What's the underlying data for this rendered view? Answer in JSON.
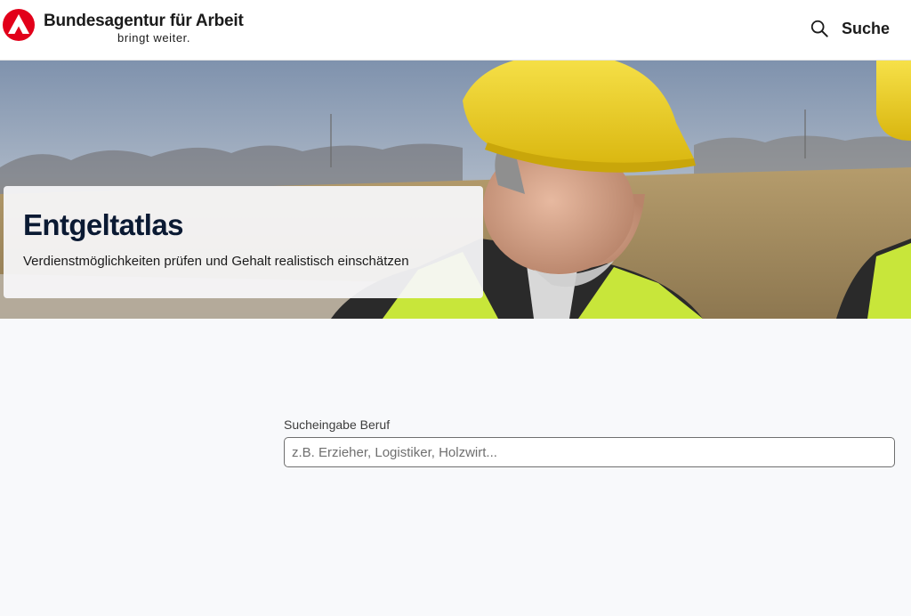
{
  "header": {
    "logo_name": "Bundesagentur für Arbeit",
    "logo_claim": "bringt weiter.",
    "logo_icon": "ba-logo-icon",
    "search_icon": "search-icon",
    "search_label": "Suche"
  },
  "hero": {
    "title": "Entgeltatlas",
    "subtitle": "Verdienstmöglichkeiten prüfen und Gehalt realistisch einschätzen"
  },
  "search": {
    "label": "Sucheingabe Beruf",
    "value": "",
    "placeholder": "z.B. Erzieher, Logistiker, Holzwirt..."
  },
  "colors": {
    "brand_red": "#e2001a",
    "title_navy": "#0b1a33",
    "page_background": "#f8f9fb",
    "helmet_yellow": "#f2d31c",
    "vest_yellow": "#c8e63a"
  }
}
